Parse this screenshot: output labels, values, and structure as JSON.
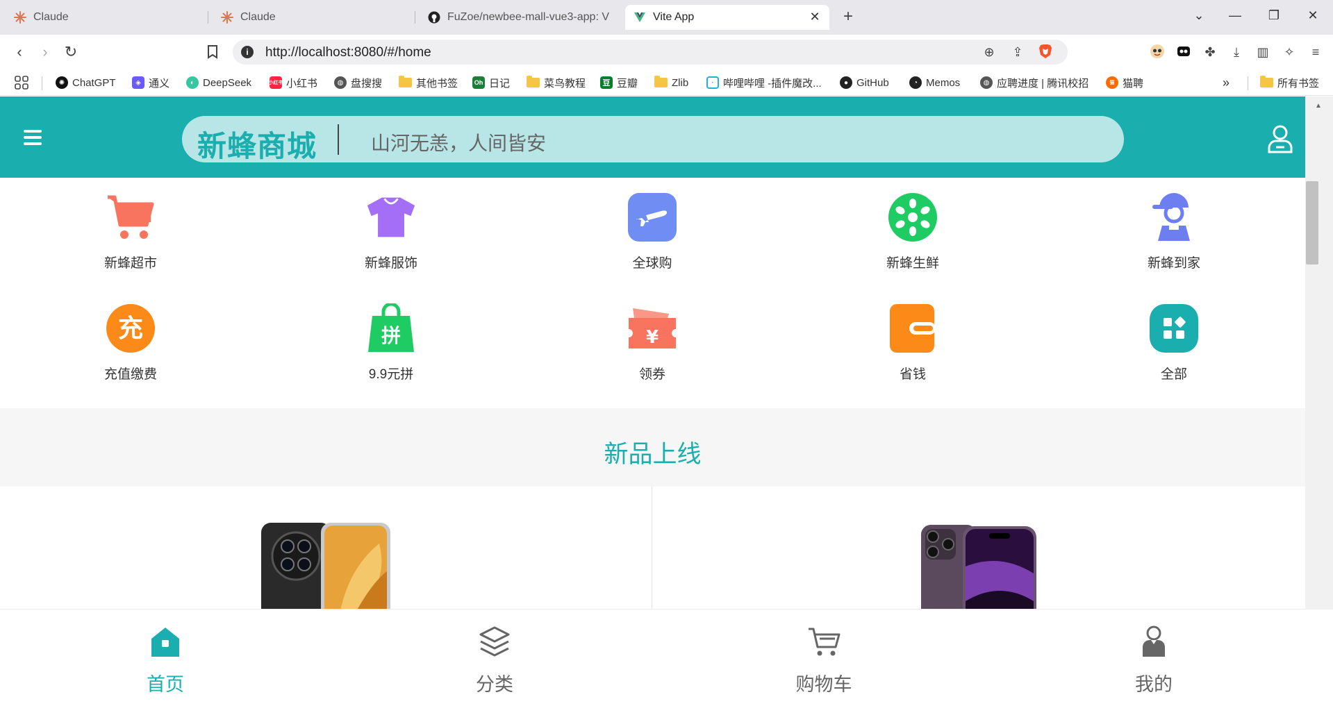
{
  "browser": {
    "tabs": [
      {
        "title": "Claude",
        "active": false
      },
      {
        "title": "Claude",
        "active": false
      },
      {
        "title": "FuZoe/newbee-mall-vue3-app: V",
        "active": false
      },
      {
        "title": "Vite App",
        "active": true
      }
    ],
    "new_tab": "+",
    "url": "http://localhost:8080/#/home",
    "bookmarks": [
      {
        "label": "ChatGPT",
        "icon": "chatgpt-icon"
      },
      {
        "label": "通义",
        "icon": "tongyi-icon"
      },
      {
        "label": "DeepSeek",
        "icon": "deepseek-icon"
      },
      {
        "label": "小红书",
        "icon": "xiaohongshu-icon"
      },
      {
        "label": "盘搜搜",
        "icon": "globe-icon"
      },
      {
        "label": "其他书签",
        "icon": "folder-icon"
      },
      {
        "label": "日记",
        "icon": "oh-icon"
      },
      {
        "label": "菜鸟教程",
        "icon": "folder-icon"
      },
      {
        "label": "豆瓣",
        "icon": "douban-icon"
      },
      {
        "label": "Zlib",
        "icon": "folder-icon"
      },
      {
        "label": "哔哩哔哩 -插件魔改...",
        "icon": "bilibili-icon"
      },
      {
        "label": "GitHub",
        "icon": "github-icon"
      },
      {
        "label": "Memos",
        "icon": "memos-icon"
      },
      {
        "label": "应聘进度 | 腾讯校招",
        "icon": "globe-icon"
      },
      {
        "label": "猫聘",
        "icon": "maopin-icon"
      }
    ],
    "more_bookmarks": "»",
    "all_bookmarks": "所有书签"
  },
  "header": {
    "brand": "新蜂商城",
    "slogan": "山河无恙，人间皆安"
  },
  "categories": [
    {
      "label": "新蜂超市",
      "icon": "cart-icon",
      "color": "#f8745f"
    },
    {
      "label": "新蜂服饰",
      "icon": "tshirt-icon",
      "color": "#a46ef7"
    },
    {
      "label": "全球购",
      "icon": "plane-icon",
      "color": "#6f8df2"
    },
    {
      "label": "新蜂生鲜",
      "icon": "kiwi-icon",
      "color": "#1fcc63"
    },
    {
      "label": "新蜂到家",
      "icon": "courier-icon",
      "color": "#6d7ff0"
    },
    {
      "label": "充值缴费",
      "icon": "recharge-icon",
      "color": "#fb8a18"
    },
    {
      "label": "9.9元拼",
      "icon": "shopping-bag-icon",
      "color": "#1fcc63"
    },
    {
      "label": "领券",
      "icon": "coupon-icon",
      "color": "#f8745f"
    },
    {
      "label": "省钱",
      "icon": "wallet-icon",
      "color": "#fb8a18"
    },
    {
      "label": "全部",
      "icon": "apps-icon",
      "color": "#1baeae"
    }
  ],
  "new_goods": {
    "title": "新品上线",
    "items": [
      {
        "image": "huawei-mate-phone"
      },
      {
        "image": "iphone-14-pro-purple"
      }
    ]
  },
  "bottom_nav": [
    {
      "label": "首页",
      "icon": "home-icon",
      "active": true
    },
    {
      "label": "分类",
      "icon": "layers-icon",
      "active": false
    },
    {
      "label": "购物车",
      "icon": "cart-outline-icon",
      "active": false
    },
    {
      "label": "我的",
      "icon": "profile-icon",
      "active": false
    }
  ],
  "colors": {
    "accent": "#1baeae",
    "search_bg": "#b8e6e6",
    "section_bg": "#f6f6f6"
  }
}
